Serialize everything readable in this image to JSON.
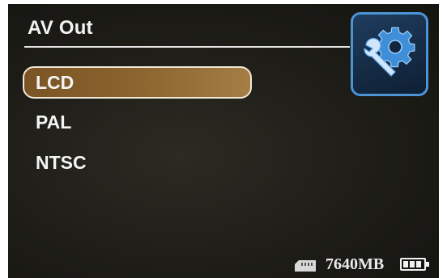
{
  "header": {
    "title": "AV Out"
  },
  "menu": {
    "items": [
      {
        "label": "LCD",
        "selected": true
      },
      {
        "label": "PAL",
        "selected": false
      },
      {
        "label": "NTSC",
        "selected": false
      }
    ]
  },
  "settings_icon": {
    "icon": "gear-wrench-icon",
    "accent": "#4b94d6"
  },
  "status_bar": {
    "storage_icon": "sd-card-icon",
    "storage_free": "7640MB",
    "battery_icon": "battery-icon",
    "battery_level": 0.75
  },
  "colors": {
    "selection_fill": "#8d6630",
    "selection_border": "#f1e7d6",
    "text": "#f4f4f4",
    "background": "#1d1c17"
  }
}
